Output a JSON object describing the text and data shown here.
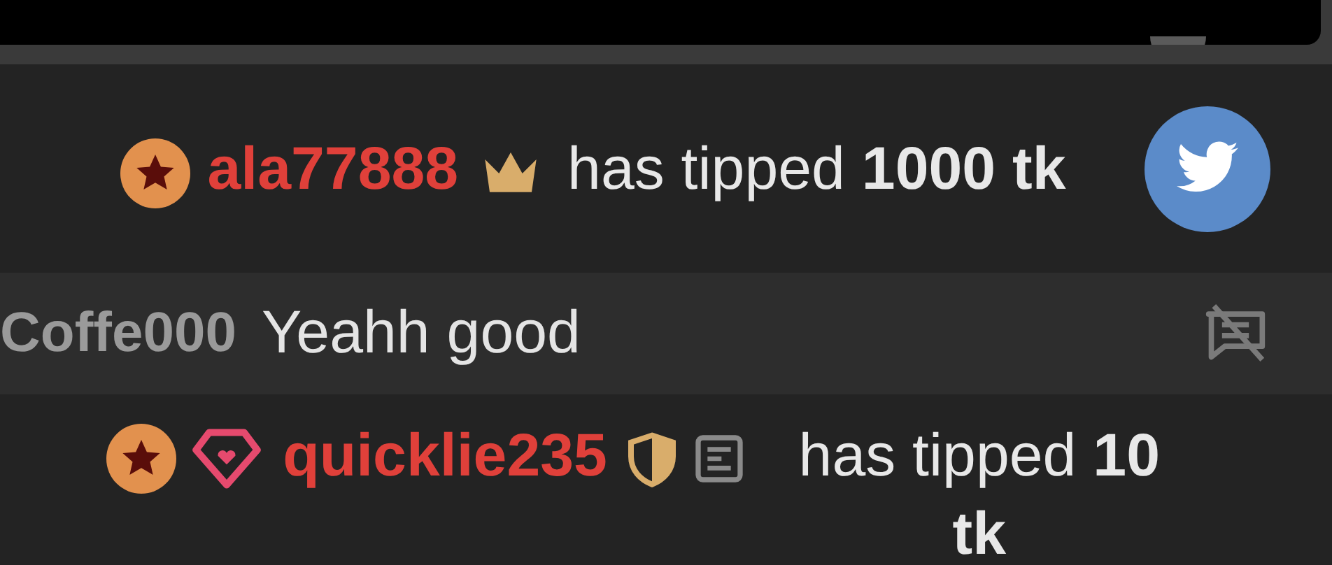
{
  "feed": [
    {
      "kind": "tip",
      "username": "ala77888",
      "badges_before": [
        {
          "kind": "rank"
        }
      ],
      "badges_after": [
        {
          "kind": "king"
        }
      ],
      "message": "has tipped **1000 tk**",
      "share": true
    },
    {
      "kind": "chat",
      "username": "Coffe000",
      "message": "Yeahh good",
      "muted": true
    },
    {
      "kind": "tip",
      "username": "quicklie235",
      "badges_before": [
        {
          "kind": "rank"
        },
        {
          "kind": "fan"
        }
      ],
      "badges_after": [
        {
          "kind": "guard"
        },
        {
          "kind": "note"
        }
      ],
      "message": "has tipped **10 tk**",
      "share": false
    }
  ]
}
